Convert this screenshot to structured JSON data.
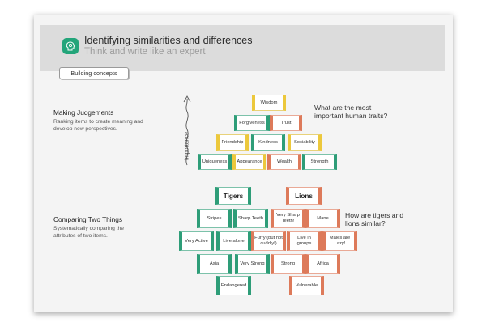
{
  "header": {
    "title": "Identifying similarities and differences",
    "subtitle": "Think and write like an expert",
    "pill_label": "Building concepts"
  },
  "sections": {
    "judgements": {
      "title": "Making Judgements",
      "description": "Ranking items to create meaning and develop new perspectives."
    },
    "comparing": {
      "title": "Comparing Two Things",
      "description": "Systematically comparing the attributes of two items."
    }
  },
  "pyramid": {
    "axis_label": "Importance",
    "question": "What are the most important human traits?",
    "blocks": [
      "Wisdom",
      "Forgiveness",
      "Trust",
      "Friendship",
      "Kindness",
      "Sociability",
      "Uniqueness",
      "Appearance",
      "Wealth",
      "Strength"
    ]
  },
  "comparison": {
    "question": "How are tigers and lions similar?",
    "tigers_label": "Tigers",
    "lions_label": "Lions",
    "tiger_blocks": [
      "Stripes",
      "Sharp Teeth",
      "Very Active",
      "Live alone",
      "Asia",
      "Very Strong",
      "Endangered"
    ],
    "lion_blocks": [
      "Very Sharp Teeth!",
      "Mane",
      "Furry (but not cuddly!)",
      "Live in groups",
      "Males are Lazy!",
      "Strong",
      "Africa",
      "Vulnerable"
    ]
  },
  "colors": {
    "yellow": "#ecc83c",
    "green": "#2e9d78",
    "orange": "#dd7a5a",
    "header_band": "#dcdcdc"
  },
  "icons": [
    "head-gears-icon",
    "importance-arrow-icon"
  ]
}
